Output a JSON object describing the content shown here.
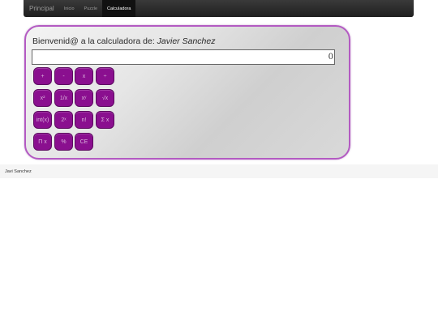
{
  "nav": {
    "brand": "Principal",
    "links": [
      {
        "label": "Inicio",
        "active": false
      },
      {
        "label": "Puzzle",
        "active": false
      },
      {
        "label": "Calculadora",
        "active": true
      }
    ]
  },
  "calculator": {
    "welcome_prefix": "Bienvenid@ a la calculadora de: ",
    "user_name": "Javier Sanchez",
    "display_value": "0",
    "keys": [
      [
        "+",
        "-",
        "x",
        "÷"
      ],
      [
        "x²",
        "1/x",
        "xʸ",
        "√x"
      ],
      [
        "int(x)",
        "2ˣ",
        "n!",
        "Σ x"
      ],
      [
        "Π x",
        "%",
        "CE"
      ]
    ]
  },
  "footer": {
    "text": "Javi Sanchez"
  },
  "colors": {
    "key_bg": "#8a0f8f",
    "panel_border": "#b35ac2",
    "navbar_bg": "#222222"
  }
}
